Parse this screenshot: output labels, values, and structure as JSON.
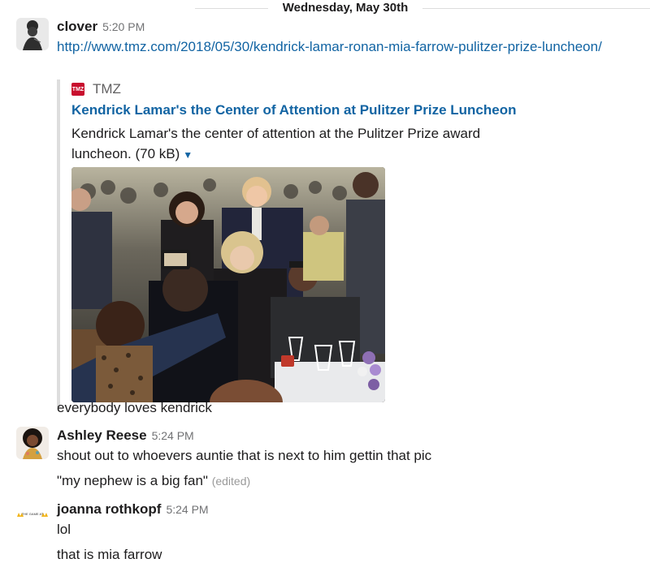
{
  "divider": {
    "date": "Wednesday, May 30th"
  },
  "messages": [
    {
      "author": "clover",
      "time": "5:20 PM",
      "link": "http://www.tmz.com/2018/05/30/kendrick-lamar-ronan-mia-farrow-pulitzer-prize-luncheon/",
      "attachment": {
        "service_logo": "TMZ",
        "service": "TMZ",
        "title": "Kendrick Lamar's the Center of Attention at Pulitzer Prize Luncheon",
        "description_line1": "Kendrick Lamar's the center of attention at the Pulitzer Prize award",
        "description_line2": "luncheon. (70 kB)",
        "caret_icon": "caret-down-icon"
      },
      "followup": "everybody loves kendrick"
    },
    {
      "author": "Ashley Reese",
      "time": "5:24 PM",
      "lines": [
        "shout out to whoevers auntie that is next to him gettin that pic",
        "\"my nephew is a big fan\""
      ],
      "edited": "(edited)"
    },
    {
      "author": "joanna rothkopf",
      "time": "5:24 PM",
      "avatar_text": "THE GAME AT",
      "lines": [
        "lol",
        "that is mia farrow"
      ]
    }
  ]
}
